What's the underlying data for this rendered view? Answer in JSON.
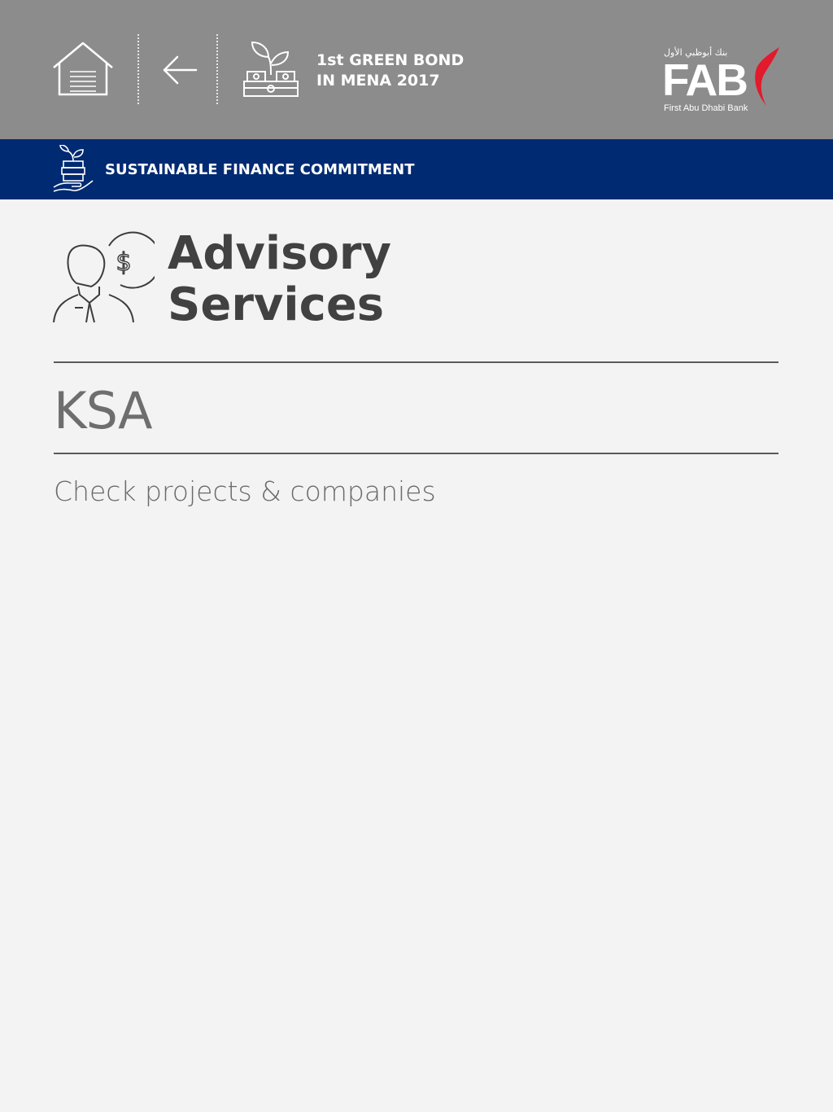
{
  "header": {
    "home_icon": "home-icon",
    "back_icon": "arrow-left-icon",
    "bond_icon": "plant-money-icon",
    "bond_line1": "1st GREEN BOND",
    "bond_line2": "IN MENA 2017",
    "logo": {
      "arabic": "بنك أبوظبي الأول",
      "wordmark": "FAB",
      "subtitle": "First Abu Dhabi Bank"
    }
  },
  "section_bar": {
    "icon": "hand-plant-coins-icon",
    "title": "SUSTAINABLE FINANCE COMMITMENT"
  },
  "page": {
    "icon": "advisor-dollar-icon",
    "title_line1": "Advisory",
    "title_line2": "Services",
    "region": "KSA",
    "link_text": "Check projects & companies"
  },
  "colors": {
    "header_bg": "#8c8c8c",
    "section_bar_bg": "#002a72",
    "page_bg": "#f3f3f3",
    "title_text": "#414141",
    "muted_text": "#6e6e6e",
    "brand_red": "#e3192c"
  }
}
